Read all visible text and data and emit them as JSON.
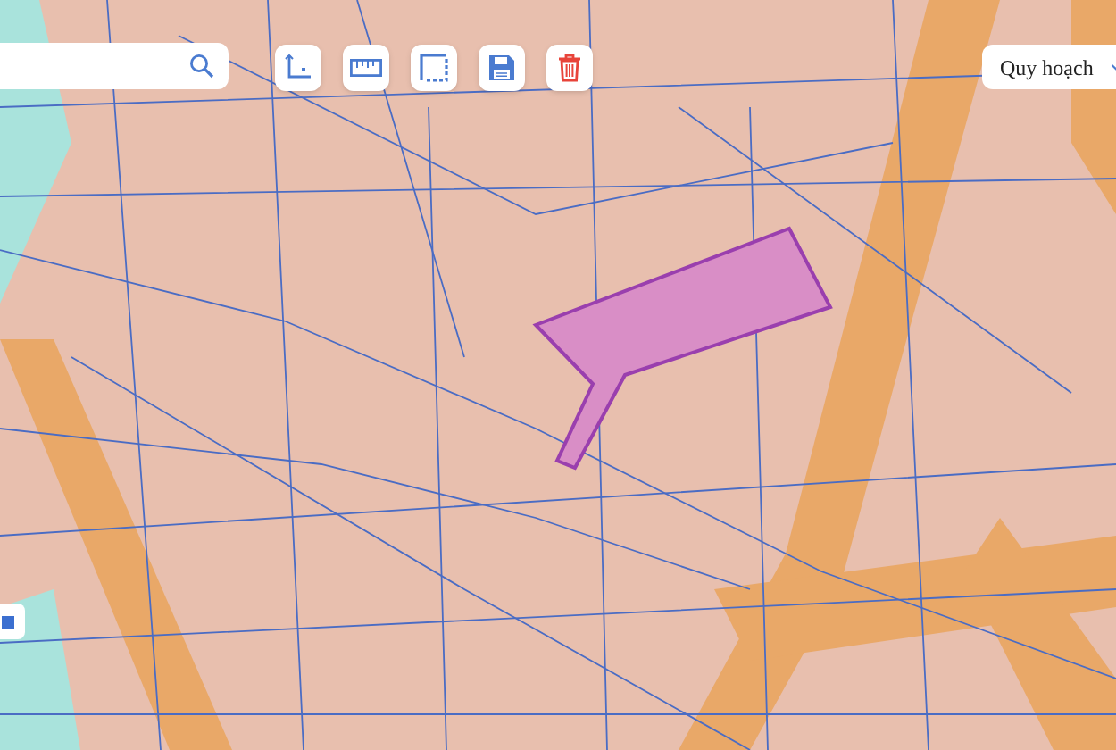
{
  "toolbar": [
    {
      "kind": "axes"
    },
    {
      "kind": "ruler"
    },
    {
      "kind": "select"
    },
    {
      "kind": "save"
    },
    {
      "kind": "delete"
    }
  ],
  "layer_select": {
    "label": "Quy hoạch"
  }
}
